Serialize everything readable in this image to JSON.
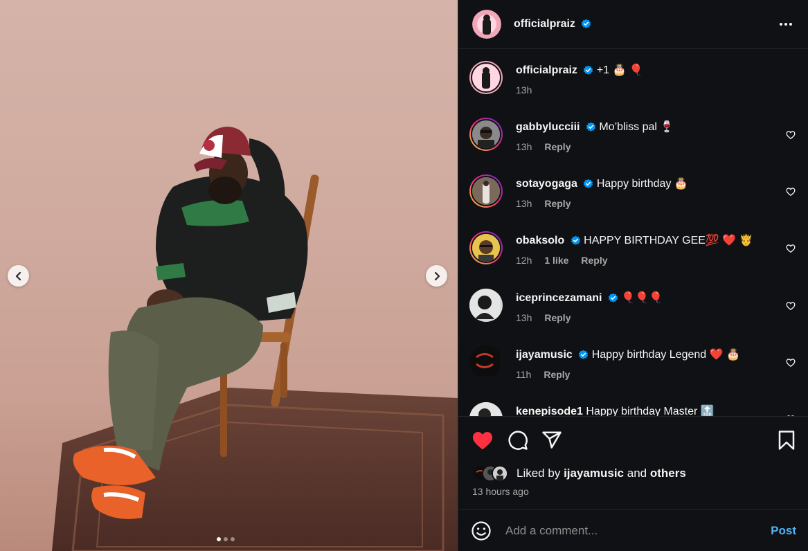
{
  "post": {
    "username": "officialpraiz",
    "caption": "+1 🎂 🎈",
    "caption_time": "13h"
  },
  "comments": [
    {
      "user": "gabbylucciii",
      "text": "Mo’bliss pal 🍷",
      "time": "13h",
      "likes": "",
      "reply": "Reply"
    },
    {
      "user": "sotayogaga",
      "text": "Happy birthday 🎂",
      "time": "13h",
      "likes": "",
      "reply": "Reply"
    },
    {
      "user": "obaksolo",
      "text": "HAPPY BIRTHDAY GEE💯 ❤️ 🤴",
      "time": "12h",
      "likes": "1 like",
      "reply": "Reply"
    },
    {
      "user": "iceprincezamani",
      "text": "🎈🎈🎈",
      "time": "13h",
      "likes": "",
      "reply": "Reply"
    },
    {
      "user": "ijayamusic",
      "text": "Happy birthday Legend ❤️ 🎂",
      "time": "11h",
      "likes": "",
      "reply": "Reply"
    },
    {
      "user": "kenepisode1",
      "text": "Happy birthday Master 🔝",
      "time": "",
      "likes": "",
      "reply": ""
    }
  ],
  "likes": {
    "prefix": "Liked by",
    "user": "ijayamusic",
    "conj": "and",
    "others": "others"
  },
  "timestamp": "13 hours ago",
  "comment_box": {
    "placeholder": "Add a comment...",
    "post_label": "Post"
  },
  "colors": {
    "like_red": "#ff3040",
    "verified_blue": "#0095f6",
    "post_blue": "#4cb5f9",
    "panel_bg": "#101114"
  },
  "carousel": {
    "current": 1,
    "total": 3
  }
}
